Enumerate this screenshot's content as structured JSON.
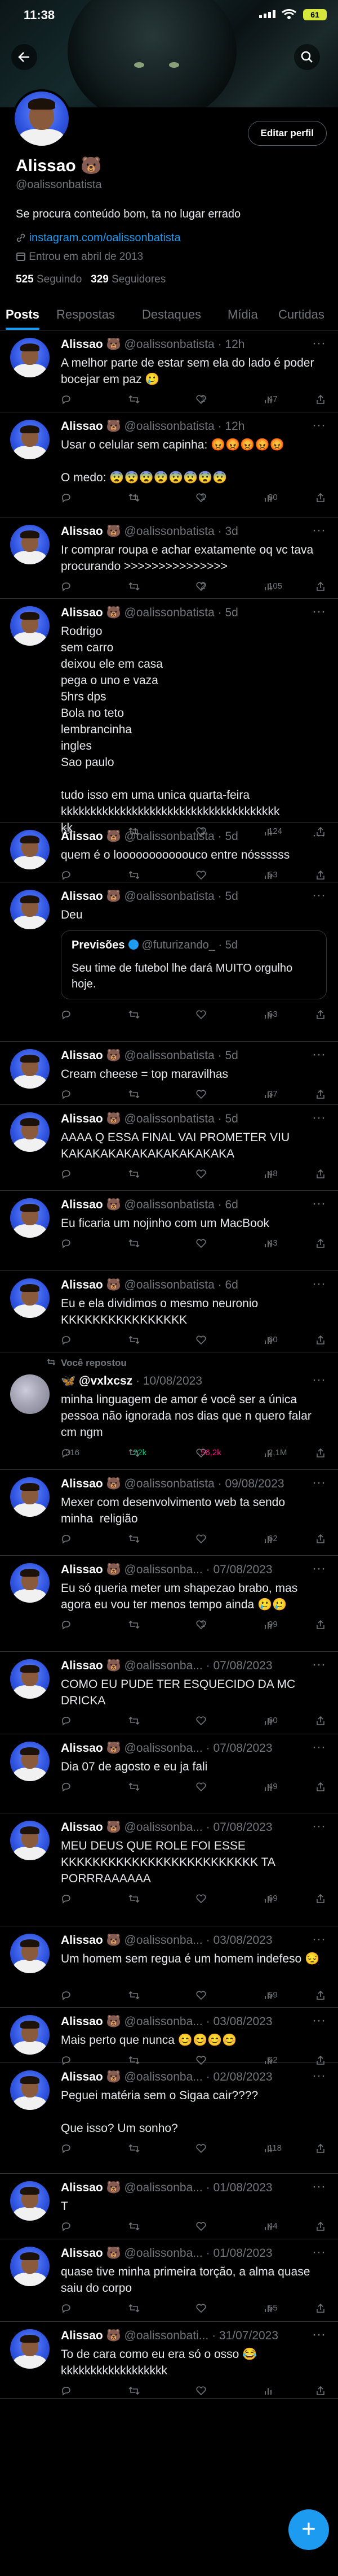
{
  "status": {
    "time": "11:38",
    "battery": "61"
  },
  "profile": {
    "name": "Alissao 🐻",
    "handle": "@oalissonbatista",
    "edit_label": "Editar perfil",
    "bio": "Se procura conteúdo bom, ta no lugar errado",
    "link": "instagram.com/oalissonbatista",
    "joined": "Entrou em abril de 2013",
    "following_count": "525",
    "following_label": "Seguindo",
    "followers_count": "329",
    "followers_label": "Seguidores"
  },
  "tabs": [
    "Posts",
    "Respostas",
    "Destaques",
    "Mídia",
    "Curtidas"
  ],
  "icons": {
    "back": "back-arrow-icon",
    "search": "search-icon",
    "compose": "plus-icon",
    "reply": "reply-icon",
    "repost": "repost-icon",
    "like": "like-icon",
    "views": "views-icon",
    "more": "more-icon"
  },
  "colors": {
    "accent": "#1d9bf0",
    "like_active": "#f91880",
    "repost_active": "#00ba7c"
  },
  "tweets": [
    {
      "name": "Alissao 🐻",
      "handle": "@oalissonbatista",
      "time": "12h",
      "text": "A melhor parte de estar sem ela do lado é poder bocejar em paz 🥲",
      "replies": "",
      "reposts": "",
      "likes": "1",
      "views": "47"
    },
    {
      "name": "Alissao 🐻",
      "handle": "@oalissonbatista",
      "time": "12h",
      "text": "Usar o celular sem capinha: 😡😡😡😡😡\n\nO medo: 😨😨😨😨😨😨😨😨",
      "replies": "",
      "reposts": "1",
      "likes": "1",
      "views": "80"
    },
    {
      "name": "Alissao 🐻",
      "handle": "@oalissonbatista",
      "time": "3d",
      "text": "Ir comprar roupa e achar exatamente oq vc tava procurando >>>>>>>>>>>>>>>",
      "replies": "",
      "reposts": "",
      "likes": "2",
      "views": "105"
    },
    {
      "name": "Alissao 🐻",
      "handle": "@oalissonbatista",
      "time": "5d",
      "text": "Rodrigo\nsem carro\ndeixou ele em casa\npega o uno e vaza\n5hrs dps\nBola no teto\nlembrancinha\ningles\nSao paulo\n\ntudo isso em uma unica quarta-feira\nkkkkkkkkkkkkkkkkkkkkkkkkkkkkkkkkkkkkk\nkk",
      "replies": "",
      "reposts": "1",
      "likes": "1",
      "views": "124"
    },
    {
      "name": "Alissao 🐻",
      "handle": "@oalissonbatista",
      "time": "5d",
      "text": "quem é o looooooooooouco entre nóssssss",
      "replies": "",
      "reposts": "",
      "likes": "",
      "views": "53"
    },
    {
      "name": "Alissao 🐻",
      "handle": "@oalissonbatista",
      "time": "5d",
      "text": "Deu",
      "replies": "",
      "reposts": "",
      "likes": "",
      "views": "63"
    },
    {
      "name": "Alissao 🐻",
      "handle": "@oalissonbatista",
      "time": "5d",
      "text": "Cream cheese = top maravilhas",
      "replies": "",
      "reposts": "",
      "likes": "",
      "views": "37"
    },
    {
      "name": "Alissao 🐻",
      "handle": "@oalissonbatista",
      "time": "5d",
      "text": "AAAA Q ESSA FINAL VAI PROMETER VIU KAKAKAKAKAKAKAKAKAKAKA",
      "replies": "",
      "reposts": "",
      "likes": "",
      "views": "48"
    },
    {
      "name": "Alissao 🐻",
      "handle": "@oalissonbatista",
      "time": "6d",
      "text": "Eu ficaria um nojinho com um MacBook",
      "replies": "",
      "reposts": "",
      "likes": "",
      "views": "43"
    },
    {
      "name": "Alissao 🐻",
      "handle": "@oalissonbatista",
      "time": "6d",
      "text": "Eu e ela dividimos o mesmo neuronio KKKKKKKKKKKKKKKK",
      "replies": "",
      "reposts": "",
      "likes": "",
      "views": "60"
    },
    {
      "name": "Alissao 🐻",
      "handle": "@oalissonbatista",
      "time": "09/08/2023",
      "text": "Mexer com desenvolvimento web ta sendo minha  religião",
      "replies": "",
      "reposts": "",
      "likes": "",
      "views": "62"
    },
    {
      "name": "Alissao 🐻",
      "handle": "@oalissonba...",
      "time": "07/08/2023",
      "text": "Eu só queria meter um shapezao brabo, mas agora eu vou ter menos tempo ainda 🥲🥲",
      "replies": "",
      "reposts": "",
      "likes": "1",
      "views": "99"
    },
    {
      "name": "Alissao 🐻",
      "handle": "@oalissonba...",
      "time": "07/08/2023",
      "text": "COMO EU PUDE TER ESQUECIDO DA MC DRICKA",
      "replies": "",
      "reposts": "",
      "likes": "",
      "views": "60"
    },
    {
      "name": "Alissao 🐻",
      "handle": "@oalissonba...",
      "time": "07/08/2023",
      "text": "Dia 07 de agosto e eu ja fali",
      "replies": "",
      "reposts": "",
      "likes": "",
      "views": "49"
    },
    {
      "name": "Alissao 🐻",
      "handle": "@oalissonba...",
      "time": "07/08/2023",
      "text": "MEU DEUS QUE ROLE FOI ESSE KKKKKKKKKKKKKKKKKKKKKKKKK TA PORRRAAAAAA",
      "replies": "",
      "reposts": "",
      "likes": "",
      "views": "69"
    },
    {
      "name": "Alissao 🐻",
      "handle": "@oalissonba...",
      "time": "03/08/2023",
      "text": "Um homem sem regua é um homem indefeso 😔",
      "replies": "",
      "reposts": "",
      "likes": "",
      "views": "59"
    },
    {
      "name": "Alissao 🐻",
      "handle": "@oalissonba...",
      "time": "03/08/2023",
      "text": "Mais perto que nunca 😊😊😊😊",
      "replies": "",
      "reposts": "",
      "likes": "",
      "views": "62"
    },
    {
      "name": "Alissao 🐻",
      "handle": "@oalissonba...",
      "time": "02/08/2023",
      "text": "Peguei matéria sem o Sigaa cair????\n\nQue isso? Um sonho?",
      "replies": "",
      "reposts": "",
      "likes": "",
      "views": "118"
    },
    {
      "name": "Alissao 🐻",
      "handle": "@oalissonba...",
      "time": "01/08/2023",
      "text": "T",
      "replies": "",
      "reposts": "",
      "likes": "",
      "views": "44"
    },
    {
      "name": "Alissao 🐻",
      "handle": "@oalissonba...",
      "time": "01/08/2023",
      "text": "quase tive minha primeira torção, a alma quase saiu do corpo",
      "replies": "",
      "reposts": "",
      "likes": "",
      "views": "55"
    },
    {
      "name": "Alissao 🐻",
      "handle": "@oalissonbati...",
      "time": "31/07/2023",
      "text": "To de cara como eu era só o osso 😂\nkkkkkkkkkkkkkkkkkk",
      "replies": "",
      "reposts": "",
      "likes": "",
      "views": ""
    }
  ],
  "quote": {
    "name": "Previsões",
    "handle": "@futurizando_",
    "time": "5d",
    "text": "Seu time de futebol lhe dará MUITO orgulho hoje."
  },
  "repost": {
    "label": "Você repostou",
    "name": "🦋 @vxlxcsz",
    "handle": "",
    "time": "10/08/2023",
    "text": "minha linguagem de amor é você ser a única pessoa não ignorada nos dias que n quero falar cm ngm",
    "replies": "316",
    "reposts": "22k",
    "likes": "56,2k",
    "views": "2,1M"
  }
}
